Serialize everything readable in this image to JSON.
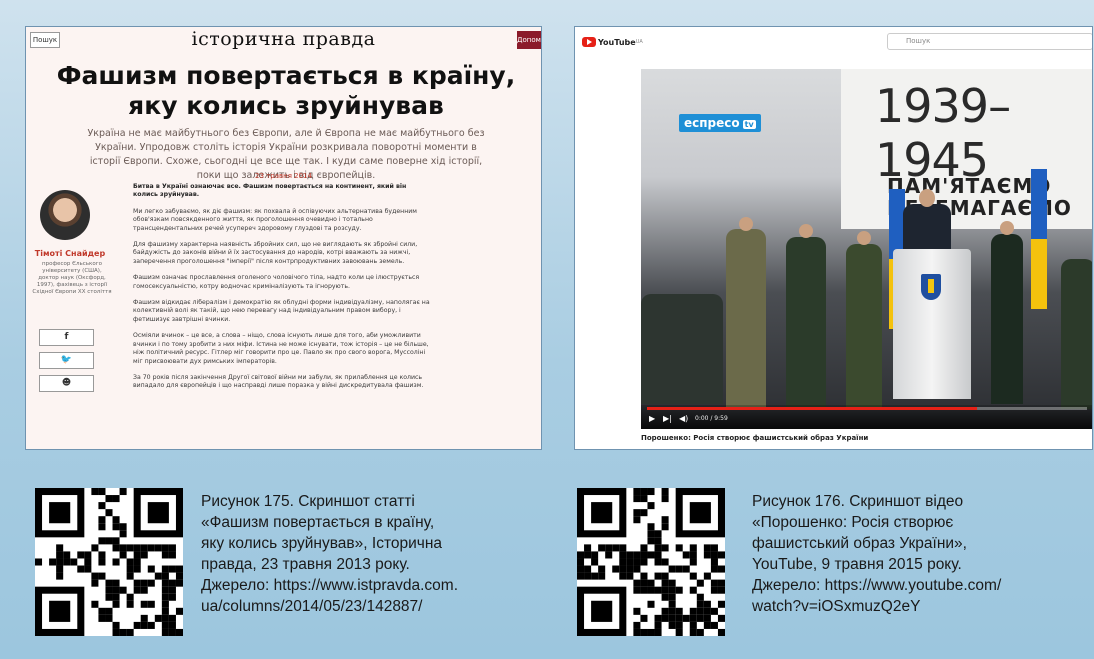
{
  "article": {
    "search_label": "Пошук",
    "logo": "історична правда",
    "donate_label": "Допомогти",
    "headline": "Фашизм повертається в країну, яку колись зруйнував",
    "lead": "Україна не має майбутнього без Європи, але й Європа не має майбутнього без України. Упродовж століть історія України розкривала поворотні моменти в історії Європи. Схоже, сьогодні це все ще так. І куди саме поверне хід історії, поки що залежить і від європейців.",
    "date": "23 травня 2014",
    "author_name": "Тімоті Снайдер",
    "author_bio": "професор Єльського університету (США), доктор наук (Оксфорд, 1997), фахівець з історії Східної Європи XX століття",
    "share_buttons": [
      "f",
      "🐦",
      "☻"
    ],
    "paragraphs": [
      "Битва в Україні ознаючає все. Фашизм повертається на континент, який він колись зруйнував.",
      "Ми легко забуваємо, як діє фашизм: як похвала й оспівуючих альтернатива буденним обов'язкам повсякденного життя, як проголошення очевидно і тотально трансцендентальних речей усупереч здоровому глуздові та розсуду.",
      "Для фашизму характерна наявність збройних сил, що не виглядають як збройні сили, байдужість до законів війни й їх застосування до народів, котрі вважають за нижчі, заперечення проголошення \"імперії\" після контрпродуктивних завоювань земель.",
      "Фашизм означає прославлення оголеного чоловічого тіла, надто коли це ілюструється гомосексуальністю, котру водночас криміналізують та ігнорують.",
      "Фашизм відкидає лібералізм і демократію як облудні форми індивідуалізму, наполягає на колективній волі як такій, що нею перевагу над індивідуальним правом вибору, і фетишизує завтрішні вчинки.",
      "Осміяли вчинок – це все, а слова – ніщо, слова існують лише для того, аби уможливити вчинки і по тому зробити з них міфи. Істина не може існувати, тож історія – це не більше, ніж політичний ресурс. Гітлер міг говорити про це. Павло як про свого ворога, Муссоліні міг присвоювати дух римських імператорів.",
      "За 70 років після закінчення Другої світової війни ми забули, як прилаблення це колись випадало для європейців і що насправді лише поразка у війні дискредитувала фашизм."
    ]
  },
  "video": {
    "logo_word": "YouTube",
    "logo_superscript": "UA",
    "search_placeholder": "Пошук",
    "channel_badge": "еспресо",
    "channel_badge_tv": "tv",
    "banner_years": "1939–1945",
    "banner_text_line1": "ПАМ'ЯТАЄМО",
    "banner_text_line2": "ПЕРЕМАГАЄМО",
    "time": "0:00 / 9:59",
    "progress": 0.75,
    "title": "Порошенко: Росія створює фашистський образ України"
  },
  "captions": {
    "left": [
      "Рисунок 175. Скриншот статті",
      "«Фашизм повертається в країну,",
      "яку колись зруйнував», Історична",
      "правда, 23 травня 2013 року.",
      "Джерело: https://www.istpravda.com.",
      "ua/columns/2014/05/23/142887/"
    ],
    "right": [
      "Рисунок 176. Скриншот відео",
      "«Порошенко: Росія створює",
      "фашистський образ України»,",
      "YouTube, 9 травня 2015 року.",
      "Джерело: https://www.youtube.com/",
      "watch?v=iOSxmuzQ2eY"
    ]
  },
  "colors": {
    "article_bg": "#fcf4f2",
    "article_accent": "#c0392b",
    "donate": "#8b1a2a",
    "youtube_red": "#e62117",
    "espreso_blue": "#1e8fd6"
  }
}
